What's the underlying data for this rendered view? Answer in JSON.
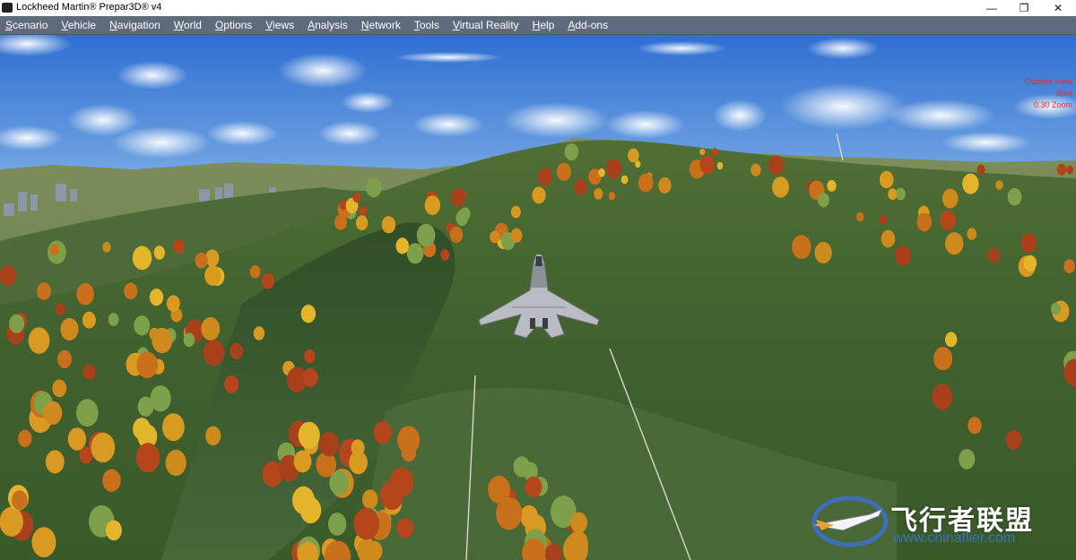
{
  "window": {
    "title": "Lockheed Martin® Prepar3D® v4",
    "controls": {
      "minimize": "—",
      "restore": "❐",
      "close": "✕"
    }
  },
  "menu": [
    {
      "name": "scenario",
      "first": "S",
      "rest": "cenario"
    },
    {
      "name": "vehicle",
      "first": "V",
      "rest": "ehicle"
    },
    {
      "name": "navigation",
      "first": "N",
      "rest": "avigation"
    },
    {
      "name": "world",
      "first": "W",
      "rest": "orld"
    },
    {
      "name": "options",
      "first": "O",
      "rest": "ptions"
    },
    {
      "name": "views",
      "first": "V",
      "rest": "iews"
    },
    {
      "name": "analysis",
      "first": "A",
      "rest": "nalysis"
    },
    {
      "name": "network",
      "first": "N",
      "rest": "etwork"
    },
    {
      "name": "tools",
      "first": "T",
      "rest": "ools"
    },
    {
      "name": "virtual-reality",
      "first": "V",
      "rest": "irtual Reality"
    },
    {
      "name": "help",
      "first": "H",
      "rest": "elp"
    },
    {
      "name": "add-ons",
      "first": "A",
      "rest": "dd-ons"
    }
  ],
  "hud": {
    "view_name": "Outside View",
    "camera": "Spot",
    "zoom": "0.30 Zoom",
    "color": "#ff2020"
  },
  "watermark": {
    "name": "飞行者联盟",
    "url": "www.chinaflier.com"
  },
  "scene": {
    "sky_top": "#2f6fd2",
    "sky_horizon": "#a9c9ea",
    "terrain_color": "#4a6a36",
    "aircraft_icon": "jet-aircraft-icon",
    "menubar_color": "#5d6b7c"
  }
}
